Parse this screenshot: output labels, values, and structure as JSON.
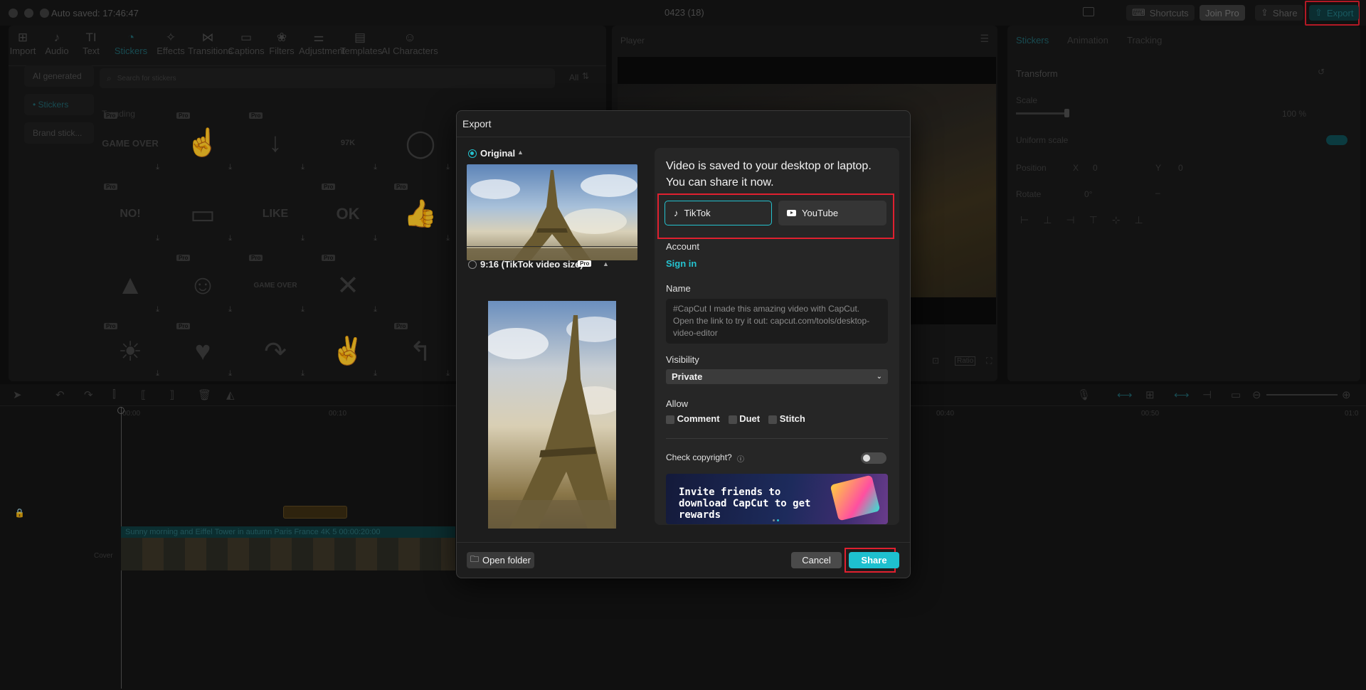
{
  "window": {
    "autosave": "Auto saved: 17:46:47",
    "title": "0423 (18)"
  },
  "topbar": {
    "shortcuts": "Shortcuts",
    "join_pro": "Join Pro",
    "share": "Share",
    "export": "Export"
  },
  "tools": [
    {
      "label": "Import",
      "icon": "import-icon",
      "glyph": "⊞"
    },
    {
      "label": "Audio",
      "icon": "audio-icon",
      "glyph": "♪"
    },
    {
      "label": "Text",
      "icon": "text-icon",
      "glyph": "TI"
    },
    {
      "label": "Stickers",
      "icon": "stickers-icon",
      "glyph": "◔"
    },
    {
      "label": "Effects",
      "icon": "effects-icon",
      "glyph": "✧"
    },
    {
      "label": "Transitions",
      "icon": "transitions-icon",
      "glyph": "⋈"
    },
    {
      "label": "Captions",
      "icon": "captions-icon",
      "glyph": "▭"
    },
    {
      "label": "Filters",
      "icon": "filters-icon",
      "glyph": "❀"
    },
    {
      "label": "Adjustment",
      "icon": "adjustment-icon",
      "glyph": "⚌"
    },
    {
      "label": "Templates",
      "icon": "templates-icon",
      "glyph": "▤"
    },
    {
      "label": "AI Characters",
      "icon": "ai-characters-icon",
      "glyph": "☺"
    }
  ],
  "sidebar": {
    "items": [
      "AI generated",
      "• Stickers",
      "Brand stick..."
    ]
  },
  "stickers": {
    "search_placeholder": "Search for stickers",
    "filter": "All",
    "section": "Trending",
    "pro": "Pro",
    "like_count": "97K",
    "game_over": "GAME OVER",
    "like": "LIKE",
    "ok": "OK",
    "no": "NO!"
  },
  "player": {
    "title": "Player",
    "ratio": "Ratio"
  },
  "inspector": {
    "tabs": [
      "Stickers",
      "Animation",
      "Tracking"
    ],
    "transform": "Transform",
    "scale": "Scale",
    "scale_value": "100 %",
    "uniform_scale": "Uniform scale",
    "position": "Position",
    "x_label": "X",
    "x_value": "0",
    "y_label": "Y",
    "y_value": "0",
    "rotate": "Rotate",
    "rotate_value": "0°",
    "dash": "–"
  },
  "timeline": {
    "t0": "00:00",
    "t1": "00:10",
    "t2": "00:40",
    "t3": "00:50",
    "t4": "01:0",
    "clip_label": "Sunny morning and Eiffel Tower in autumn Paris France 4K 5   00:00:20:00",
    "cover": "Cover"
  },
  "modal": {
    "title": "Export",
    "original_label": "Original",
    "tiktok_size_label": "9:16 (TikTok video size)",
    "pro_badge": "Pro",
    "message": "Video is saved to your desktop or laptop. You can share it now.",
    "platforms": {
      "tiktok": "TikTok",
      "youtube": "YouTube"
    },
    "account_label": "Account",
    "sign_in": "Sign in",
    "name_label": "Name",
    "name_placeholder": "#CapCut I made this amazing video with CapCut. Open the link to try it out: capcut.com/tools/desktop-video-editor",
    "visibility_label": "Visibility",
    "visibility_value": "Private",
    "allow_label": "Allow",
    "allow": {
      "comment": "Comment",
      "duet": "Duet",
      "stitch": "Stitch"
    },
    "copyright_label": "Check copyright?",
    "banner_text": "Invite friends to download CapCut to get rewards",
    "open_folder": "Open folder",
    "cancel": "Cancel",
    "share": "Share"
  },
  "colors": {
    "accent": "#25c2cf",
    "highlight": "#e0202f",
    "share_button": "#1ec0cf"
  }
}
